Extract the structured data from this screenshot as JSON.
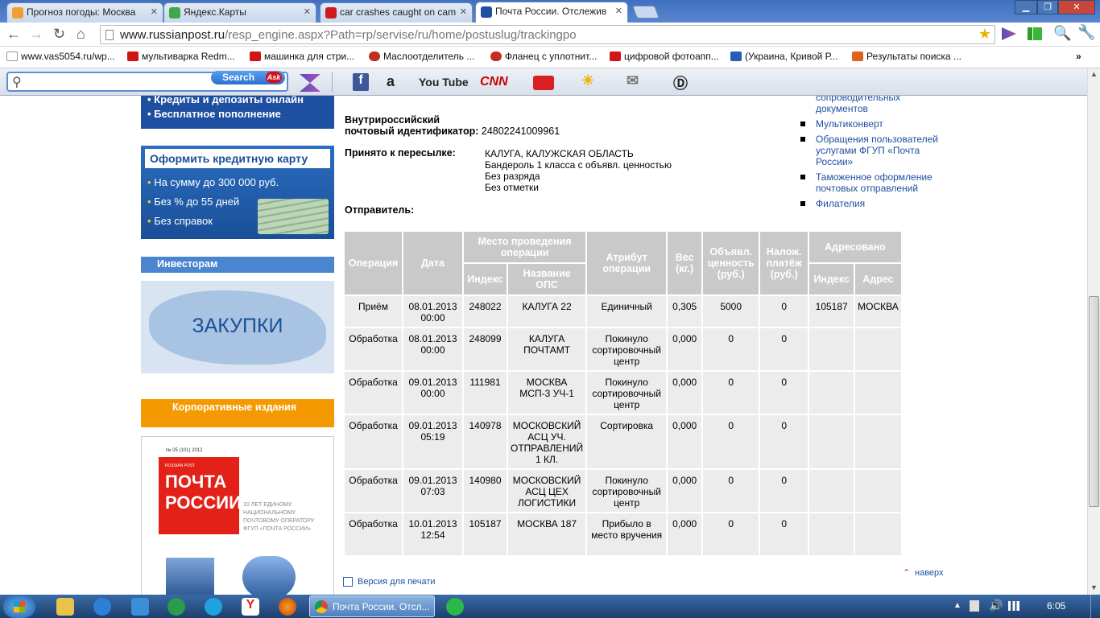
{
  "browser": {
    "tabs": [
      {
        "title": "Прогноз погоды: Москва",
        "color": "#f0a030"
      },
      {
        "title": "Яндекс.Карты",
        "color": "#3fa84a"
      },
      {
        "title": "car crashes caught on cam",
        "color": "#cc1b1b"
      },
      {
        "title": "Почта России. Отслежив",
        "color": "#1f4fa0"
      }
    ],
    "url_host": "www.russianpost.ru",
    "url_path": "/resp_engine.aspx?Path=rp/servise/ru/home/postuslug/trackingpo",
    "bookmarks": [
      {
        "label": "www.vas5054.ru/wp...",
        "color": "#888"
      },
      {
        "label": "мультиварка Redm...",
        "color": "#d01515"
      },
      {
        "label": "машинка для стри...",
        "color": "#d01515"
      },
      {
        "label": "Маслоотделитель ...",
        "color": "#c03020"
      },
      {
        "label": "Фланец с уплотнит...",
        "color": "#c03020"
      },
      {
        "label": "цифровой фотоапп...",
        "color": "#d01515"
      },
      {
        "label": "(Украина, Кривой Р...",
        "color": "#2a5db0"
      },
      {
        "label": "Результаты поиска ...",
        "color": "#e06020"
      }
    ],
    "ask_search_label": "Search",
    "ask_brand": "Ask",
    "ask_icons": {
      "youtube": "You Tube",
      "cnn": "CNN"
    }
  },
  "left": {
    "credit_lines": [
      "Кредиты и депозиты онлайн",
      "Бесплатное пополнение"
    ],
    "card_promo": {
      "title": "Оформить кредитную карту",
      "items": [
        "На сумму до 300 000 руб.",
        "Без % до 55 дней",
        "Без справок"
      ]
    },
    "investors": "Инвесторам",
    "zakupki": "ЗАКУПКИ",
    "corporate": "Корпоративные издания",
    "magazine": {
      "issue": "№ 05 (101) 2012",
      "brand_small": "RUSSIAN POST",
      "brand_line1": "ПОЧТА",
      "brand_line2": "РОССИИ",
      "caption": "10 ЛЕТ ЕДИНОМУ НАЦИОНАЛЬНОМУ ПОЧТОВОМУ ОПЕРАТОРУ ФГУП «ПОЧТА РОССИИ»"
    }
  },
  "info": {
    "id_label_1": "Внутрироссийский",
    "id_label_2": "почтовый идентификатор:",
    "id_value": "24802241009961",
    "accepted_label": "Принято к пересылке:",
    "accepted_lines": [
      "КАЛУГА, КАЛУЖСКАЯ ОБЛАСТЬ",
      "Бандероль 1 класса с объявл. ценностью",
      "Без разряда",
      "Без отметки"
    ],
    "sender_label": "Отправитель:"
  },
  "right_links": [
    "сопроводительных документов",
    "Мультиконверт",
    "Обращения пользователей услугами ФГУП «Почта России»",
    "Таможенное оформление почтовых отправлений",
    "Филателия"
  ],
  "table": {
    "headers": {
      "operation": "Операция",
      "date": "Дата",
      "place": "Место проведения операции",
      "index": "Индекс",
      "ops_name": "Название ОПС",
      "attribute": "Атрибут операции",
      "weight": "Вес (кг.)",
      "declared": "Объявл. ценность (руб.)",
      "cod": "Налож. платёж (руб.)",
      "addressed": "Адресовано",
      "addr_index": "Индекс",
      "address": "Адрес"
    },
    "rows": [
      {
        "op": "Приём",
        "date": "08.01.2013 00:00",
        "idx": "248022",
        "name": "КАЛУГА 22",
        "attr": "Единичный",
        "weight": "0,305",
        "declared": "5000",
        "cod": "0",
        "aidx": "105187",
        "addr": "МОСКВА"
      },
      {
        "op": "Обработка",
        "date": "08.01.2013 00:00",
        "idx": "248099",
        "name": "КАЛУГА ПОЧТАМТ",
        "attr": "Покинуло сортировочный центр",
        "weight": "0,000",
        "declared": "0",
        "cod": "0",
        "aidx": "",
        "addr": ""
      },
      {
        "op": "Обработка",
        "date": "09.01.2013 00:00",
        "idx": "111981",
        "name": "МОСКВА МСП-3 УЧ-1",
        "attr": "Покинуло сортировочный центр",
        "weight": "0,000",
        "declared": "0",
        "cod": "0",
        "aidx": "",
        "addr": ""
      },
      {
        "op": "Обработка",
        "date": "09.01.2013 05:19",
        "idx": "140978",
        "name": "МОСКОВСКИЙ АСЦ УЧ. ОТПРАВЛЕНИЙ 1 КЛ.",
        "attr": "Сортировка",
        "weight": "0,000",
        "declared": "0",
        "cod": "0",
        "aidx": "",
        "addr": ""
      },
      {
        "op": "Обработка",
        "date": "09.01.2013 07:03",
        "idx": "140980",
        "name": "МОСКОВСКИЙ АСЦ ЦЕХ ЛОГИСТИКИ",
        "attr": "Покинуло сортировочный центр",
        "weight": "0,000",
        "declared": "0",
        "cod": "0",
        "aidx": "",
        "addr": ""
      },
      {
        "op": "Обработка",
        "date": "10.01.2013 12:54",
        "idx": "105187",
        "name": "МОСКВА 187",
        "attr": "Прибыло в место вручения",
        "weight": "0,000",
        "declared": "0",
        "cod": "0",
        "aidx": "",
        "addr": ""
      }
    ]
  },
  "footer": {
    "print_version": "Версия для печати",
    "to_top": "наверх"
  },
  "taskbar": {
    "active_window": "Почта России. Отсл...",
    "clock": "6:05"
  }
}
